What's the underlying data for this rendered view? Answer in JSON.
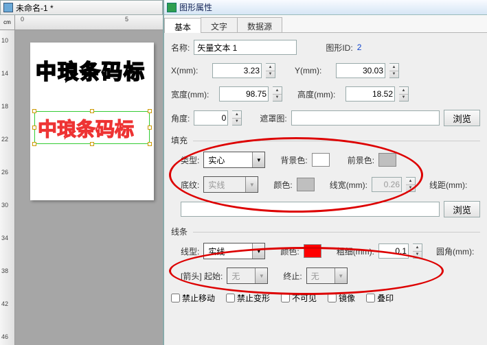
{
  "left": {
    "title": "未命名-1 *",
    "ruler_unit": "cm",
    "hruler_marks": [
      "0",
      "5"
    ],
    "vruler_marks": [
      "10",
      "14",
      "18",
      "22",
      "26",
      "30",
      "34",
      "38",
      "42",
      "46"
    ],
    "text1": "中琅条码标",
    "text2": "中琅条码标"
  },
  "panel": {
    "title": "图形属性",
    "tabs": {
      "basic": "基本",
      "text": "文字",
      "datasource": "数据源"
    },
    "name_label": "名称:",
    "name_value": "矢量文本 1",
    "id_label": "图形ID:",
    "id_value": "2",
    "x_label": "X(mm):",
    "x_value": "3.23",
    "y_label": "Y(mm):",
    "y_value": "30.03",
    "w_label": "宽度(mm):",
    "w_value": "98.75",
    "h_label": "高度(mm):",
    "h_value": "18.52",
    "angle_label": "角度:",
    "angle_value": "0",
    "mask_label": "遮罩图:",
    "browse": "浏览",
    "fill_group": "填充",
    "type_label": "类型:",
    "type_value": "实心",
    "bgcolor_label": "背景色:",
    "fgcolor_label": "前景色:",
    "pattern_label": "底纹:",
    "pattern_value": "实线",
    "color_label": "颜色:",
    "linew_label": "线宽(mm):",
    "linew_value": "0.26",
    "lined_label": "线距(mm):",
    "line_group": "线条",
    "linetype_label": "线型:",
    "linetype_value": "实线",
    "thick_label": "粗细(mm):",
    "thick_value": "0.1",
    "corner_label": "圆角(mm):",
    "arrow_label": "[箭头] 起始:",
    "arrow_start": "无",
    "arrow_end_label": "终止:",
    "arrow_end": "无",
    "chk_lockmove": "禁止移动",
    "chk_lockscale": "禁止变形",
    "chk_invisible": "不可见",
    "chk_mirror": "镜像",
    "chk_overprint": "叠印"
  },
  "colors": {
    "bg": "#ffffff",
    "fg": "#bfbfbf",
    "pattern": "#bfbfbf",
    "line": "#ff0000"
  }
}
